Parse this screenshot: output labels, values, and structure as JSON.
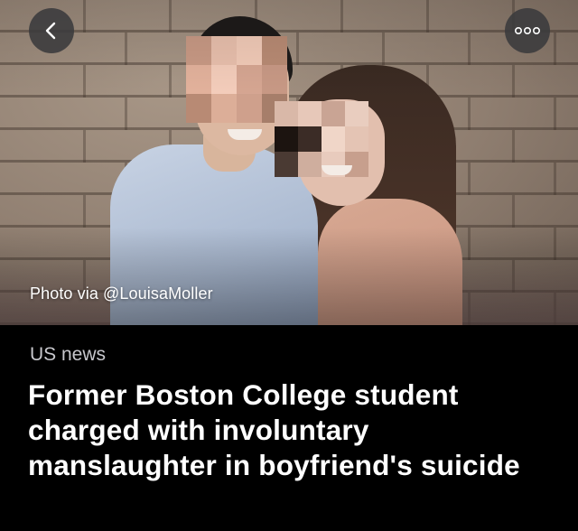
{
  "nav": {
    "back_icon": "chevron-left-icon",
    "more_icon": "ellipsis-icon"
  },
  "hero": {
    "caption": "Photo via @LouisaMoller"
  },
  "article": {
    "section": "US news",
    "headline": "Former Boston College student charged with involuntary manslaughter in boyfriend's suicide"
  },
  "colors": {
    "background": "#000000",
    "headline_text": "#ffffff",
    "section_text": "#c7c7cc",
    "button_bg": "#3a3a3c"
  }
}
